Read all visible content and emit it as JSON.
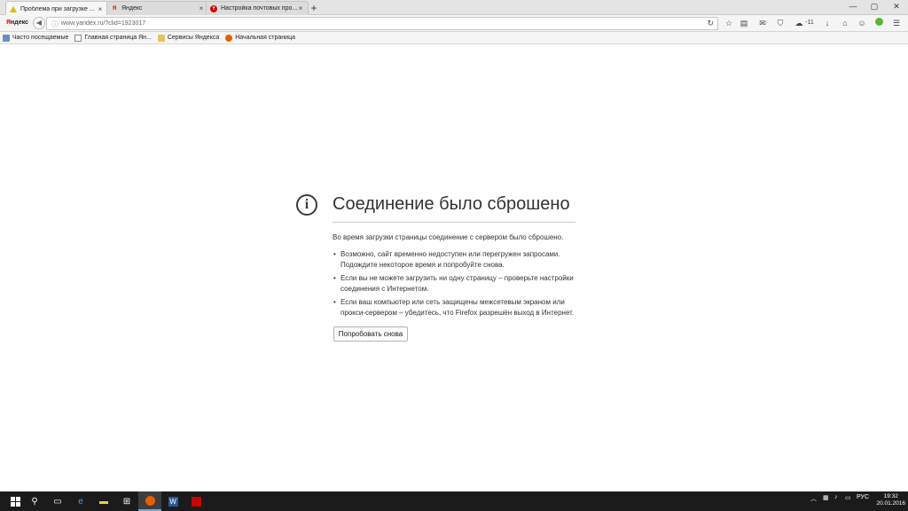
{
  "tabs": [
    {
      "title": "Проблема при загрузке ...",
      "icon": "warning-icon",
      "active": true
    },
    {
      "title": "Яндекс",
      "icon": "yandex-icon",
      "active": false
    },
    {
      "title": "Настройка почтовых про...",
      "icon": "yandex-mail-icon",
      "active": false
    }
  ],
  "tab_close_glyph": "×",
  "new_tab_glyph": "+",
  "window": {
    "minimize": "—",
    "maximize": "▢",
    "close": "✕"
  },
  "navbar": {
    "brand_first": "Я",
    "brand_rest": "ндекс",
    "url": "www.yandex.ru/?clid=1923017",
    "counter": "-11"
  },
  "bookmarks": [
    {
      "label": "Часто посещаемые",
      "icon": "star-icon"
    },
    {
      "label": "Главная страница Ян...",
      "icon": "page-icon"
    },
    {
      "label": "Сервисы Яндекса",
      "icon": "folder-icon"
    },
    {
      "label": "Начальная страница",
      "icon": "firefox-icon"
    }
  ],
  "error": {
    "icon_glyph": "i",
    "title": "Соединение было сброшено",
    "intro": "Во время загрузки страницы соединение с сервером было сброшено.",
    "bullets": [
      "Возможно, сайт временно недоступен или перегружен запросами. Подождите некоторое время и попробуйте снова.",
      "Если вы не можете загрузить ни одну страницу – проверьте настройки соединения с Интернетом.",
      "Если ваш компьютер или сеть защищены межсетевым экраном или прокси-сервером – убедитесь, что Firefox разрешён выход в Интернет."
    ],
    "retry_label": "Попробовать снова"
  },
  "taskbar": {
    "lang": "РУС",
    "time": "19:32",
    "date": "20.01.2016"
  }
}
